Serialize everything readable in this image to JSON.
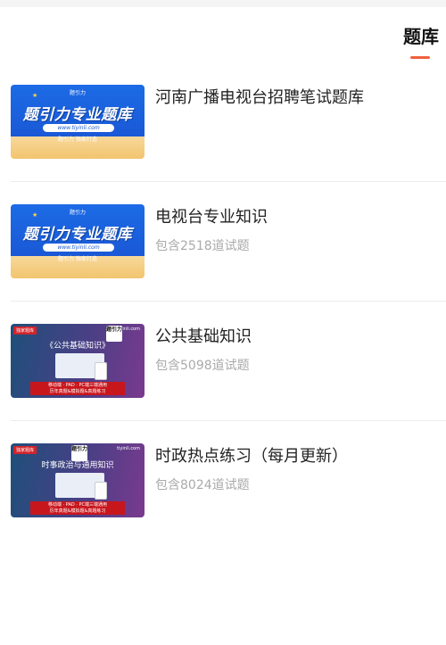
{
  "tabs": {
    "active_label": "题库"
  },
  "items": [
    {
      "title": "河南广播电视台招聘笔试题库",
      "count": "",
      "thumb": {
        "style": "blue",
        "headline": "题引力专业题库",
        "url": "www.tiyinli.com",
        "slogan": "题引力 独家打造",
        "logo": "题引力"
      }
    },
    {
      "title": "电视台专业知识",
      "count": "包含2518道试题",
      "thumb": {
        "style": "blue",
        "headline": "题引力专业题库",
        "url": "www.tiyinli.com",
        "slogan": "题引力 独家打造",
        "logo": "题引力"
      }
    },
    {
      "title": "公共基础知识",
      "count": "包含5098道试题",
      "thumb": {
        "style": "purple",
        "tag": "独家题库",
        "site": "tiyinli.com",
        "heading": "《公共基础知识》",
        "badge": "题引力",
        "box_line1": "移动端 · PAD · PC端三端通用",
        "box_line2": "历年真题&模拟题&真题练习"
      }
    },
    {
      "title": "时政热点练习（每月更新）",
      "count": "包含8024道试题",
      "thumb": {
        "style": "purple",
        "tag": "独家题库",
        "site": "tiyinli.com",
        "heading": "时事政治与通用知识",
        "badge": "题引力",
        "box_line1": "移动端 · PAD · PC端三端通用",
        "box_line2": "历年真题&模拟题&真题练习"
      }
    }
  ],
  "colors": {
    "accent": "#f0603c",
    "title": "#222222",
    "muted": "#aaaaaa",
    "divider": "#ececec"
  }
}
